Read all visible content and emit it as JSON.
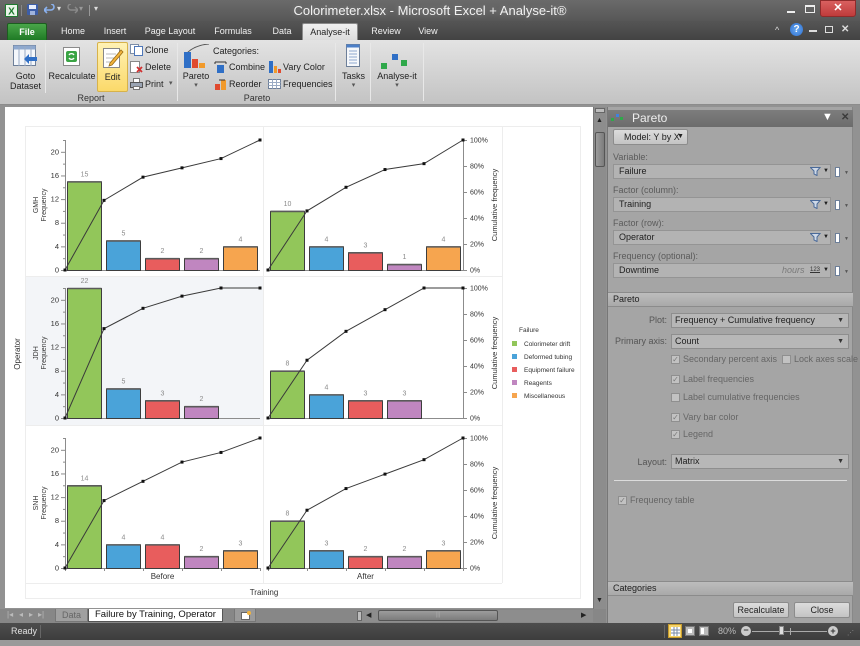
{
  "window": {
    "title": "Colorimeter.xlsx - Microsoft Excel + Analyse-it®",
    "controls": [
      "minimize",
      "maximize",
      "close"
    ]
  },
  "tabs": [
    {
      "label": "File"
    },
    {
      "label": "Home"
    },
    {
      "label": "Insert"
    },
    {
      "label": "Page Layout"
    },
    {
      "label": "Formulas"
    },
    {
      "label": "Data"
    },
    {
      "label": "Analyse-it",
      "active": true
    },
    {
      "label": "Review"
    },
    {
      "label": "View"
    }
  ],
  "ribbon": {
    "report": {
      "group_label": "Report",
      "goto_line1": "Goto",
      "goto_line2": "Dataset",
      "recalculate": "Recalculate",
      "edit": "Edit",
      "clone": "Clone",
      "delete": "Delete",
      "print": "Print"
    },
    "pareto": {
      "group_label": "Pareto",
      "pareto": "Pareto",
      "categories_heading": "Categories:",
      "combine": "Combine",
      "reorder": "Reorder",
      "vary_color": "Vary Color",
      "frequencies": "Frequencies"
    },
    "tasks": "Tasks",
    "analyse_it": "Analyse-it",
    "dropdown_glyph": "▾"
  },
  "sheet_tabs": [
    {
      "label": "Data",
      "active": false
    },
    {
      "label": "Failure by Training, Operator",
      "active": true
    }
  ],
  "status_bar": {
    "ready": "Ready",
    "zoom_label": "80%",
    "zoom_percent": 80
  },
  "task_pane": {
    "title": "Pareto",
    "model_button": "Model: Y by X",
    "fields": [
      {
        "label": "Variable:",
        "value": "Failure"
      },
      {
        "label": "Factor (column):",
        "value": "Training"
      },
      {
        "label": "Factor (row):",
        "value": "Operator"
      },
      {
        "label": "Frequency (optional):",
        "value": "Downtime",
        "unit": "hours",
        "type_icon": "123"
      }
    ],
    "pareto_section": {
      "heading": "Pareto",
      "plot_label": "Plot:",
      "plot_value": "Frequency + Cumulative frequency",
      "primary_axis_label": "Primary axis:",
      "primary_axis_value": "Count",
      "checkboxes": [
        {
          "label": "Secondary percent axis",
          "checked": true
        },
        {
          "label": "Lock axes scale",
          "checked": false
        },
        {
          "label": "Label frequencies",
          "checked": true
        },
        {
          "label": "Label cumulative frequencies",
          "checked": false
        },
        {
          "label": "Vary bar color",
          "checked": true
        },
        {
          "label": "Legend",
          "checked": true
        }
      ],
      "layout_label": "Layout:",
      "layout_value": "Matrix",
      "frequency_table": {
        "label": "Frequency table",
        "checked": true
      }
    },
    "categories_heading": "Categories",
    "recalculate_button": "Recalculate",
    "close_button": "Close"
  },
  "chart_data": {
    "type": "bar",
    "subtype": "pareto-matrix",
    "xlabel": "Training",
    "ylabel": "Operator",
    "columns": [
      "Before",
      "After"
    ],
    "rows": [
      "GMH",
      "JDH",
      "SNH"
    ],
    "primary_axis_label": "Frequency",
    "secondary_axis_label": "Cumulative frequency",
    "categories": [
      "Colorimeter drift",
      "Deformed tubing",
      "Equipment failure",
      "Reagents",
      "Miscellaneous"
    ],
    "colors": [
      "#92c65a",
      "#4aa3d9",
      "#e85d5d",
      "#c086c0",
      "#f6a54f"
    ],
    "ylim": [
      0,
      22
    ],
    "yticks": [
      0,
      4,
      8,
      12,
      16,
      20
    ],
    "secondary_ylim": [
      0,
      100
    ],
    "secondary_ticks": [
      0,
      20,
      40,
      60,
      80,
      100
    ],
    "series": [
      {
        "name": "Frequency",
        "type": "bar",
        "axis": "primary"
      },
      {
        "name": "Cumulative frequency",
        "type": "line",
        "axis": "secondary"
      }
    ],
    "panels": [
      {
        "row": "GMH",
        "column": "Before",
        "values": [
          15,
          5,
          2,
          2,
          4
        ]
      },
      {
        "row": "GMH",
        "column": "After",
        "values": [
          10,
          4,
          3,
          1,
          4
        ]
      },
      {
        "row": "JDH",
        "column": "Before",
        "values": [
          22,
          5,
          3,
          2,
          0
        ],
        "selected": true
      },
      {
        "row": "JDH",
        "column": "After",
        "values": [
          8,
          4,
          3,
          3,
          0
        ]
      },
      {
        "row": "SNH",
        "column": "Before",
        "values": [
          14,
          4,
          4,
          2,
          3
        ]
      },
      {
        "row": "SNH",
        "column": "After",
        "values": [
          8,
          3,
          2,
          2,
          3
        ]
      }
    ],
    "bar_labels": true,
    "legend": {
      "title": "Failure",
      "position": "right"
    },
    "grid": false
  }
}
